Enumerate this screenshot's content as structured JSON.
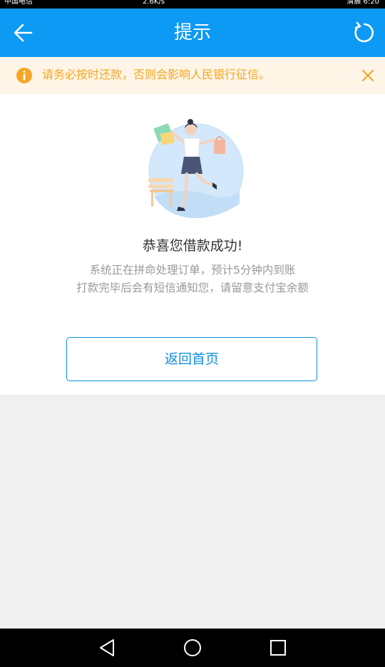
{
  "status_bar": {
    "carrier": "中国电信",
    "time_area": "2.6K/s",
    "right": "清晨 6:20"
  },
  "header": {
    "title": "提示",
    "background": "#0c9af5"
  },
  "notice": {
    "text": "请务必按时还款，否则会影响人民银行征信。",
    "icon": "info-icon",
    "color": "#f5a623",
    "background": "#fef5e6"
  },
  "main": {
    "title": "恭喜您借款成功!",
    "description_line1": "系统正在拼命处理订单，预计5分钟内到账",
    "description_line2": "打款完毕后会有短信通知您，请留意支付宝余额",
    "home_button_label": "返回首页",
    "accent": "#0c8fe3"
  },
  "android_nav": {
    "icons": [
      "back-triangle-icon",
      "home-circle-icon",
      "recents-square-icon"
    ]
  }
}
